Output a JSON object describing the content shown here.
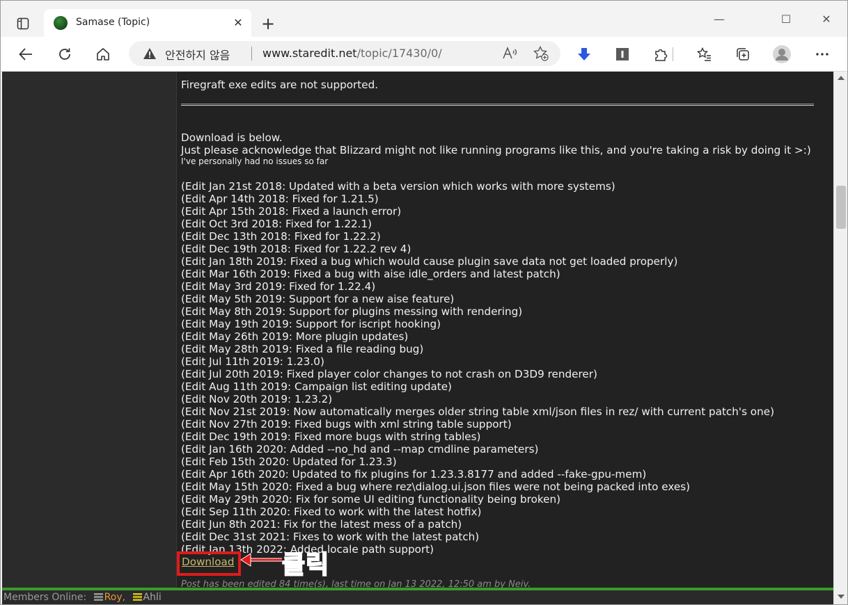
{
  "browser": {
    "tab_title": "Samase (Topic)",
    "tab_close": "✕",
    "new_tab": "+",
    "minimize": "—",
    "maximize": "☐",
    "close": "✕",
    "security_label": "안전하지 않음",
    "url_host": "www.staredit.net",
    "url_path": "/topic/17430/0/",
    "read_aloud": "A))"
  },
  "post": {
    "unsupported": "Firegraft exe edits are not supported.",
    "download_intro": "Download is below.",
    "acknowledge": "Just please acknowledge that Blizzard might not like running programs like this, and you're taking a risk by doing it >:)",
    "no_issues": "I've personally had no issues so far",
    "edits": [
      "(Edit Jan 21st 2018: Updated with a beta version which works with more systems)",
      "(Edit Apr 14th 2018: Fixed for 1.21.5)",
      "(Edit Apr 15th 2018: Fixed a launch error)",
      "(Edit Oct 3rd 2018: Fixed for 1.22.1)",
      "(Edit Dec 13th 2018: Fixed for 1.22.2)",
      "(Edit Dec 19th 2018: Fixed for 1.22.2 rev 4)",
      "(Edit Jan 18th 2019: Fixed a bug which would cause plugin save data not get loaded properly)",
      "(Edit Mar 16th 2019: Fixed a bug with aise idle_orders and latest patch)",
      "(Edit May 3rd 2019: Fixed for 1.22.4)",
      "(Edit May 5th 2019: Support for a new aise feature)",
      "(Edit May 8th 2019: Support for plugins messing with rendering)",
      "(Edit May 19th 2019: Support for iscript hooking)",
      "(Edit May 26th 2019: More plugin updates)",
      "(Edit May 28th 2019: Fixed a file reading bug)",
      "(Edit Jul 11th 2019: 1.23.0)",
      "(Edit Jul 20th 2019: Fixed player color changes to not crash on D3D9 renderer)",
      "(Edit Aug 11th 2019: Campaign list editing update)",
      "(Edit Nov 20th 2019: 1.23.2)",
      "(Edit Nov 21st 2019: Now automatically merges older string table xml/json files in rez/ with current patch's one)",
      "(Edit Nov 27th 2019: Fixed bugs with xml string table support)",
      "(Edit Dec 19th 2019: Fixed more bugs with string tables)",
      "(Edit Jan 16th 2020: Added --no_hd and --map cmdline parameters)",
      "(Edit Feb 15th 2020: Updated for 1.23.3)",
      "(Edit Apr 16th 2020: Updated to fix plugins for 1.23.3.8177 and added --fake-gpu-mem)",
      "(Edit May 15th 2020: Fixed a bug where rez\\dialog.ui.json files were not being packed into exes)",
      "(Edit May 29th 2020: Fix for some UI editing functionality being broken)",
      "(Edit Sep 11th 2020: Fixed to work with the latest hotfix)",
      "(Edit Jun 8th 2021: Fix for the latest mess of a patch)",
      "(Edit Dec 31st 2021: Fixes to work with the latest patch)",
      "(Edit Jan 13th 2022: Added locale path support)"
    ],
    "download_link": "Download",
    "edited_note": "Post has been edited 84 time(s), last time on Jan 13 2022, 12:50 am by Neiv."
  },
  "annotation": {
    "label": "클릭",
    "color": "#e01a1a"
  },
  "members": {
    "label": "Members Online:",
    "user1": "Roy",
    "separator": ",",
    "user2": "Ahli",
    "user1_color": "#e8973a",
    "user2_color": "#a9a9a9"
  },
  "colors": {
    "page_bg": "#222222",
    "link": "#c7b769",
    "accent_green": "#3c9a2c",
    "download_icon": "#2b58e0"
  }
}
